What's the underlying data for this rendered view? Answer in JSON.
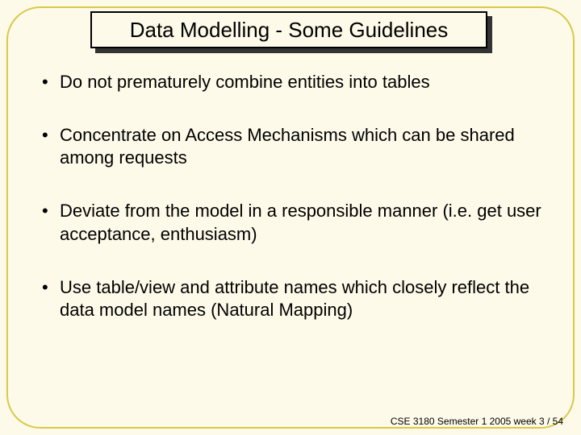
{
  "title": "Data Modelling - Some Guidelines",
  "bullets": [
    "Do not prematurely combine entities into tables",
    "Concentrate on Access Mechanisms which can be shared among requests",
    "Deviate from the model in a responsible manner (i.e. get user acceptance, enthusiasm)",
    "Use table/view and attribute names which closely reflect the data model names (Natural Mapping)"
  ],
  "footer": "CSE 3180 Semester 1 2005  week 3 / 54"
}
